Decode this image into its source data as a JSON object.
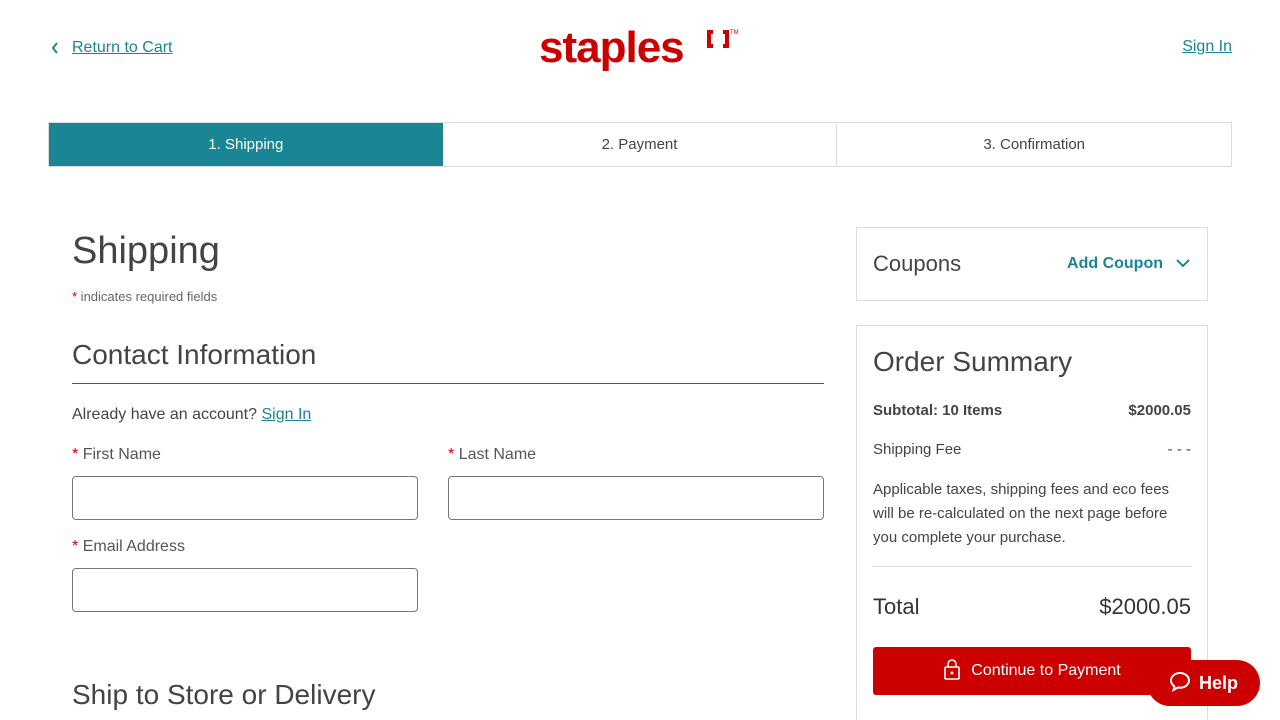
{
  "header": {
    "return_label": "Return to Cart",
    "logo_text": "staples",
    "sign_in_label": "Sign In"
  },
  "steps": [
    {
      "label": "1. Shipping",
      "active": true
    },
    {
      "label": "2. Payment",
      "active": false
    },
    {
      "label": "3. Confirmation",
      "active": false
    }
  ],
  "main": {
    "title": "Shipping",
    "required_star": "*",
    "required_note": " indicates required fields",
    "contact_title": "Contact Information",
    "already_text": "Already have an account?",
    "already_link": "Sign In",
    "fields": {
      "first_name": {
        "label": "First Name",
        "value": ""
      },
      "last_name": {
        "label": "Last Name",
        "value": ""
      },
      "email": {
        "label": "Email Address",
        "value": ""
      }
    },
    "ship_title": "Ship to Store or Delivery"
  },
  "coupons": {
    "title": "Coupons",
    "add_label": "Add Coupon"
  },
  "summary": {
    "title": "Order Summary",
    "subtotal_label": "Subtotal: 10 Items",
    "subtotal_value": "$2000.05",
    "shipping_label": "Shipping Fee",
    "shipping_value": "- - -",
    "note": "Applicable taxes, shipping fees and eco fees will be re-calculated on the next page before you complete your purchase.",
    "total_label": "Total",
    "total_value": "$2000.05",
    "cta_label": "Continue to Payment"
  },
  "help": {
    "label": "Help"
  },
  "colors": {
    "brand_red": "#cc0000",
    "accent_teal": "#1a8595"
  }
}
